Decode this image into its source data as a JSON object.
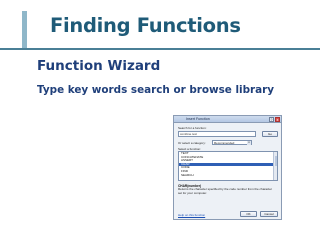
{
  "slide": {
    "title": "Finding Functions",
    "subtitle": "Function Wizard",
    "body": "Type key words search or browse library"
  },
  "dialog": {
    "title": "Insert Function",
    "help_button": "?",
    "close_button": "x",
    "search_label": "Search for a function:",
    "search_value": "combine text",
    "go_button": "Go",
    "category_label": "Or select a category:",
    "category_value": "Recommended",
    "select_label": "Select a function:",
    "functions": [
      "TEXT",
      "CONCATENATE",
      "ASSERT",
      "CHAR",
      "CODE",
      "FIND",
      "SEARCH"
    ],
    "selected_index": 3,
    "signature": "CHAR(number)",
    "description": "Returns the character specified by the code number from the character set for your computer.",
    "help_link": "Help on this function",
    "ok_button": "OK",
    "cancel_button": "Cancel"
  },
  "colors": {
    "title": "#1f5b78",
    "text": "#1f3f7a",
    "accent_bar": "#8fb7c9",
    "selection": "#2f5fb5"
  }
}
